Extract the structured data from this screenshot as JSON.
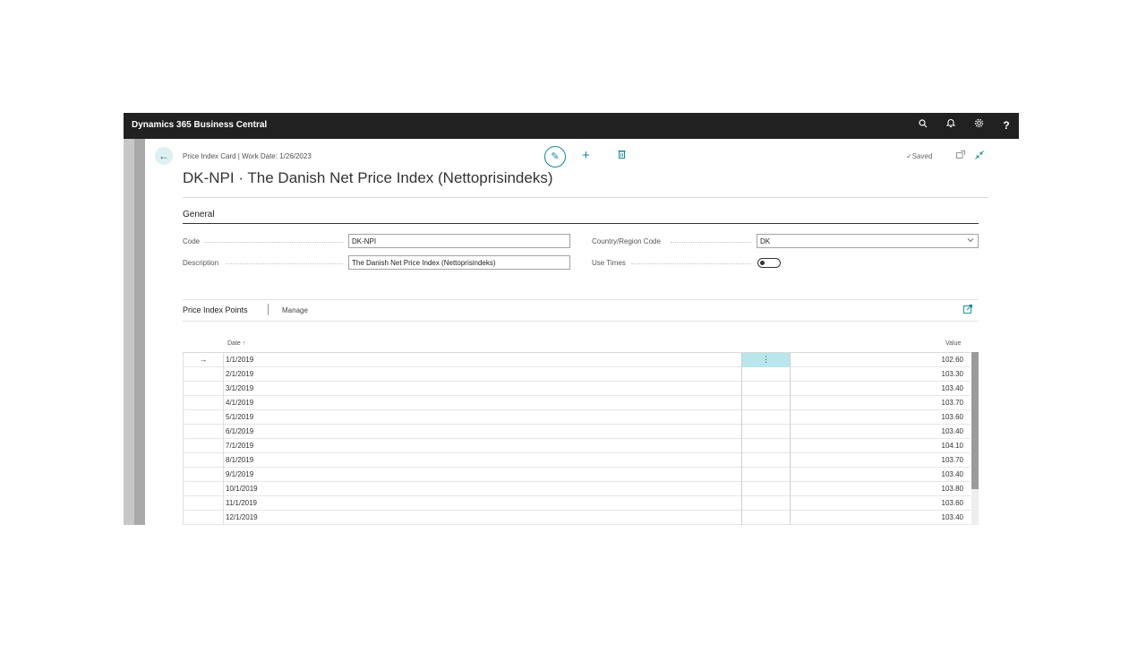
{
  "app": {
    "title": "Dynamics 365 Business Central"
  },
  "topbar": {
    "icons": [
      "search-icon",
      "bell-icon",
      "gear-icon",
      "help-icon"
    ],
    "help_label": "?"
  },
  "page": {
    "breadcrumb": "Price Index Card | Work Date: 1/26/2023",
    "title": "DK-NPI · The Danish Net Price Index (Nettoprisindeks)",
    "status": "Saved"
  },
  "general": {
    "heading": "General",
    "code_label": "Code",
    "code_value": "DK-NPI",
    "description_label": "Description",
    "description_value": "The Danish Net Price Index (Nettoprisindeks)",
    "country_label": "Country/Region Code",
    "country_value": "DK",
    "use_times_label": "Use Times",
    "use_times_value": false
  },
  "points": {
    "title": "Price Index Points",
    "manage_label": "Manage",
    "col_date": "Date ↑",
    "col_value": "Value",
    "rows": [
      {
        "date": "1/1/2019",
        "value": "102.60"
      },
      {
        "date": "2/1/2019",
        "value": "103.30"
      },
      {
        "date": "3/1/2019",
        "value": "103.40"
      },
      {
        "date": "4/1/2019",
        "value": "103.70"
      },
      {
        "date": "5/1/2019",
        "value": "103.60"
      },
      {
        "date": "6/1/2019",
        "value": "103.40"
      },
      {
        "date": "7/1/2019",
        "value": "104.10"
      },
      {
        "date": "8/1/2019",
        "value": "103.70"
      },
      {
        "date": "9/1/2019",
        "value": "103.40"
      },
      {
        "date": "10/1/2019",
        "value": "103.80"
      },
      {
        "date": "11/1/2019",
        "value": "103.60"
      },
      {
        "date": "12/1/2019",
        "value": "103.40"
      }
    ]
  }
}
